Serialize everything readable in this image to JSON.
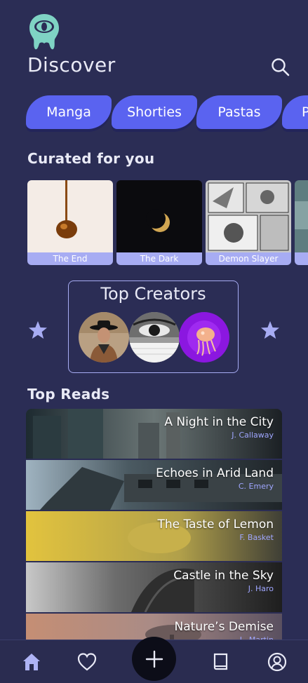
{
  "header": {
    "title": "Discover",
    "logo_icon": "eye-drop-logo-icon",
    "search_icon": "search-icon"
  },
  "categories": [
    {
      "label": "Manga"
    },
    {
      "label": "Shorties"
    },
    {
      "label": "Pastas"
    },
    {
      "label": "P"
    }
  ],
  "curated": {
    "title": "Curated for you",
    "cards": [
      {
        "label": "The End"
      },
      {
        "label": "The Dark"
      },
      {
        "label": "Demon Slayer"
      },
      {
        "label": ""
      }
    ]
  },
  "top_creators": {
    "title": "Top Creators",
    "left_icon": "star-icon",
    "right_icon": "star-icon"
  },
  "top_reads": {
    "title": "Top Reads",
    "items": [
      {
        "title": "A Night in the City",
        "author": "J. Callaway"
      },
      {
        "title": "Echoes in Arid Land",
        "author": "C. Emery"
      },
      {
        "title": "The Taste of Lemon",
        "author": "F. Basket"
      },
      {
        "title": "Castle in the Sky",
        "author": "J. Haro"
      },
      {
        "title": "Nature’s Demise",
        "author": "L. Martin"
      }
    ]
  },
  "bottom_nav": {
    "items": [
      "home-icon",
      "heart-icon",
      "plus-icon",
      "book-icon",
      "profile-icon"
    ],
    "active": "home-icon"
  },
  "colors": {
    "background": "#2b2d55",
    "accent": "#5a63f0",
    "accent_light": "#a7acf3",
    "logo": "#7fd3c4"
  }
}
